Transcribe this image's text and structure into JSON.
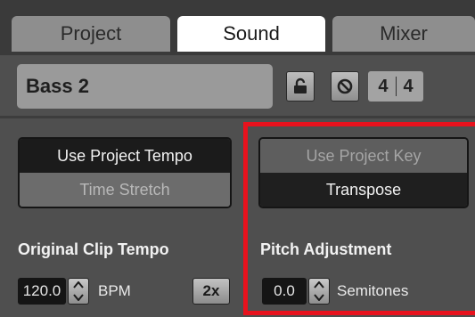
{
  "tabs": [
    {
      "label": "Project",
      "active": false
    },
    {
      "label": "Sound",
      "active": true
    },
    {
      "label": "Mixer",
      "active": false
    }
  ],
  "sound": {
    "name": "Bass 2",
    "time_signature": {
      "numerator": "4",
      "denominator": "4"
    }
  },
  "tempo": {
    "use_project_tempo_label": "Use Project Tempo",
    "time_stretch_label": "Time Stretch",
    "section_label": "Original Clip Tempo",
    "value": "120.0",
    "unit": "BPM",
    "double_label": "2x"
  },
  "pitch": {
    "use_project_key_label": "Use Project Key",
    "transpose_label": "Transpose",
    "section_label": "Pitch Adjustment",
    "value": "0.0",
    "unit": "Semitones"
  },
  "icons": {
    "lock": "lock-icon",
    "block": "block-icon",
    "stepper": "up-down-arrows-icon"
  },
  "colors": {
    "highlight": "#e8121d",
    "panel_bg": "#4f4f4f",
    "active_tab": "#ffffff"
  }
}
